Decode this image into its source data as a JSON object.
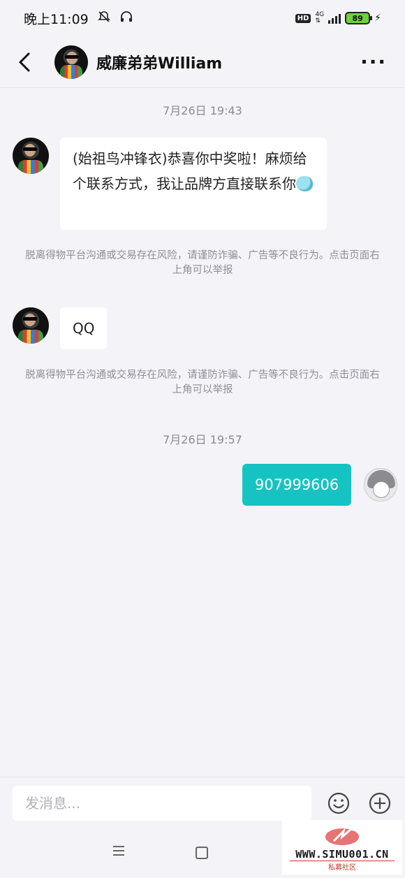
{
  "status_bar": {
    "time": "晚上11:09",
    "hd": "HD",
    "network": "4G",
    "battery": "89"
  },
  "header": {
    "title": "威廉弟弟William",
    "more": "···"
  },
  "messages": {
    "ts1": "7月26日 19:43",
    "msg1_text": "(始祖鸟冲锋衣)恭喜你中奖啦！麻烦给个联系方式，我让品牌方直接联系你",
    "notice1": "脱离得物平台沟通或交易存在风险，请谨防诈骗、广告等不良行为。点击页面右上角可以举报",
    "msg2_text": "QQ",
    "notice2": "脱离得物平台沟通或交易存在风险，请谨防诈骗、广告等不良行为。点击页面右上角可以举报",
    "ts2": "7月26日 19:57",
    "msg3_text": "907999606"
  },
  "input": {
    "placeholder": "发消息..."
  },
  "nav": {
    "menu": "☰"
  },
  "watermark": {
    "site": "WWW.SIMU001.CN",
    "sub": "私募社区"
  },
  "colors": {
    "accent": "#15c4c2",
    "background": "#f4f4f8"
  }
}
